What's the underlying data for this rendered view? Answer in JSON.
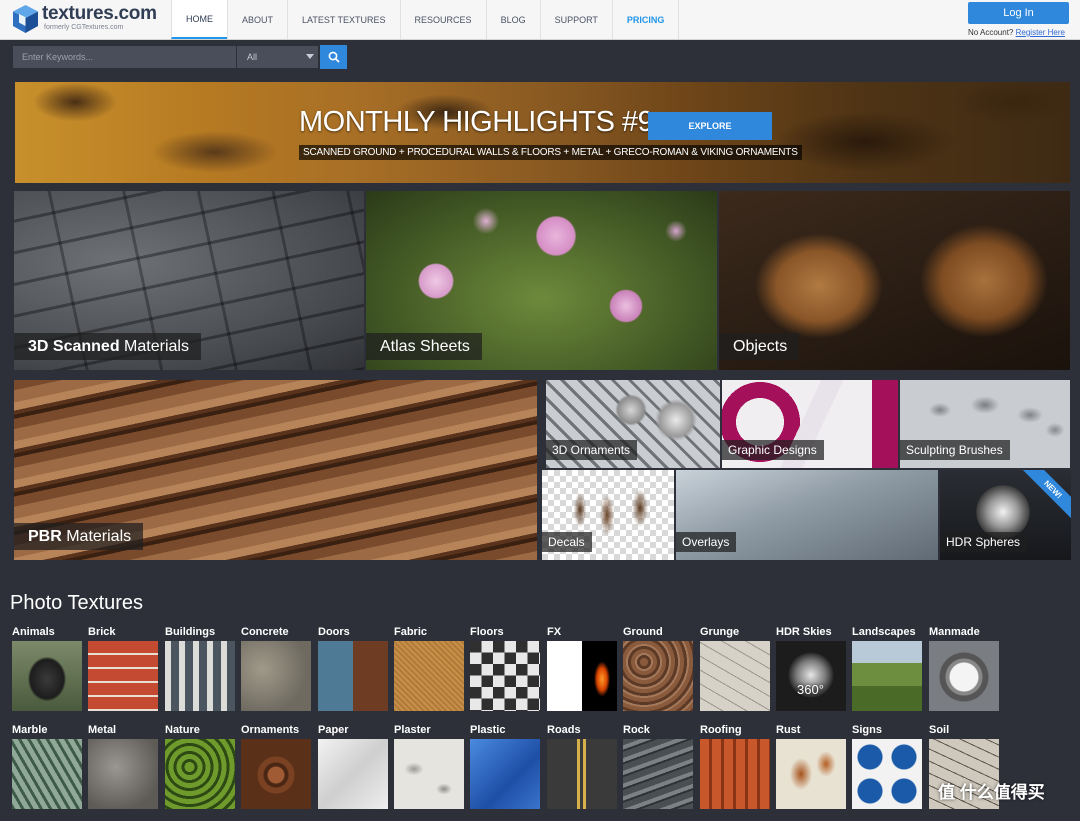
{
  "header": {
    "logo_name": "textures.com",
    "logo_sub": "formerly CGTextures.com",
    "nav": [
      "HOME",
      "ABOUT",
      "LATEST TEXTURES",
      "RESOURCES",
      "BLOG",
      "SUPPORT",
      "PRICING"
    ],
    "active_nav": "HOME",
    "login_label": "Log In",
    "no_account_text": "No Account?",
    "register_label": "Register Here"
  },
  "search": {
    "placeholder": "Enter Keywords...",
    "category": "All"
  },
  "banner": {
    "title": "MONTHLY HIGHLIGHTS #9",
    "subtitle": "SCANNED GROUND + PROCEDURAL WALLS & FLOORS + METAL + GRECO-ROMAN & VIKING ORNAMENTS",
    "button": "EXPLORE"
  },
  "tiles": {
    "scanned": {
      "bold": "3D Scanned",
      "rest": " Materials"
    },
    "atlas": "Atlas Sheets",
    "objects": "Objects",
    "pbr": {
      "bold": "PBR",
      "rest": " Materials"
    },
    "ornaments": "3D Ornaments",
    "graphic": "Graphic Designs",
    "sculpting": "Sculpting Brushes",
    "decals": "Decals",
    "overlays": "Overlays",
    "hdr_spheres": "HDR Spheres",
    "new_badge": "NEW!"
  },
  "photo_textures": {
    "title": "Photo Textures",
    "row1": [
      "Animals",
      "Brick",
      "Buildings",
      "Concrete",
      "Doors",
      "Fabric",
      "Floors",
      "FX",
      "Ground",
      "Grunge",
      "HDR Skies",
      "Landscapes",
      "Manmade"
    ],
    "row2": [
      "Marble",
      "Metal",
      "Nature",
      "Ornaments",
      "Paper",
      "Plaster",
      "Plastic",
      "Roads",
      "Rock",
      "Roofing",
      "Rust",
      "Signs",
      "Soil"
    ],
    "hdr_badge": "360°"
  },
  "watermark": "值 什么值得买"
}
